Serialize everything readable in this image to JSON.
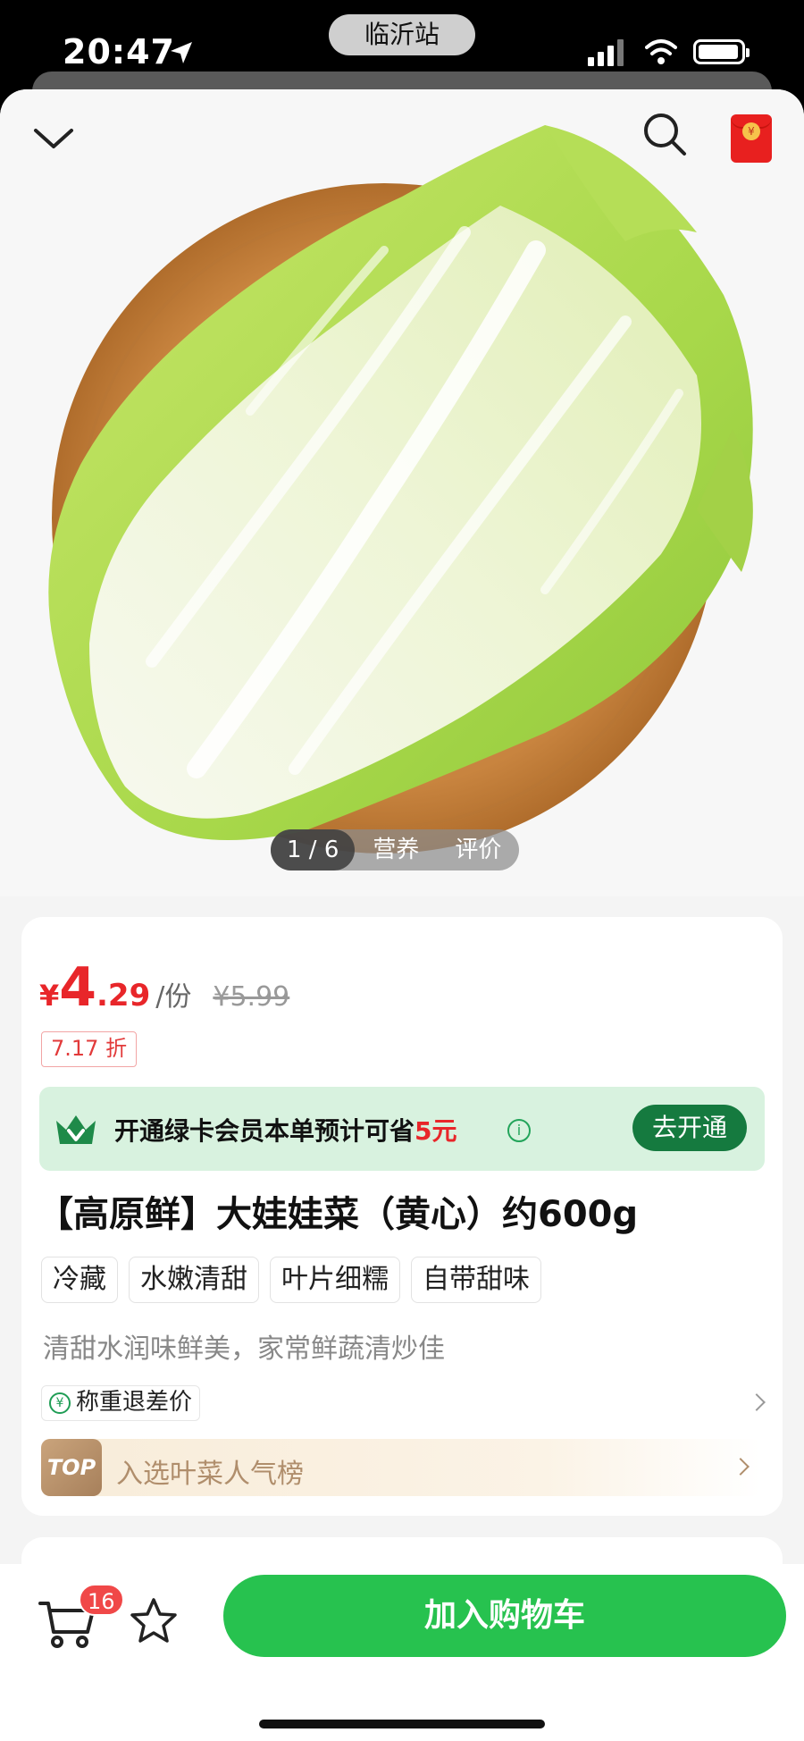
{
  "status_bar": {
    "time": "20:47",
    "station": "临沂站"
  },
  "gallery": {
    "image_subject": "napa cabbage on wooden plate",
    "pager_count": "1 / 6",
    "tabs": [
      "营养",
      "评价"
    ]
  },
  "price": {
    "currency": "¥",
    "integer": "4",
    "decimal": ".29",
    "unit": "/份",
    "original": "¥5.99",
    "discount": "7.17 折"
  },
  "member_banner": {
    "text_before": "开通绿卡会员本单预计可省",
    "save_amount": "5元",
    "info_glyph": "i",
    "cta": "去开通"
  },
  "product": {
    "title": "【高原鲜】大娃娃菜（黄心）约600g",
    "tags": [
      "冷藏",
      "水嫩清甜",
      "叶片细糯",
      "自带甜味"
    ],
    "subtitle": "清甜水润味鲜美，家常鲜蔬清炒佳",
    "refund_icon_glyph": "¥",
    "refund_label": "称重退差价",
    "rank_badge": "TOP",
    "rank_label": "入选叶菜人气榜"
  },
  "bottom_bar": {
    "cart_count": "16",
    "add_to_cart": "加入购物车"
  },
  "colors": {
    "price_red": "#e8262a",
    "member_green": "#157a3f",
    "cta_green": "#27c24f",
    "badge_red": "#f04848"
  }
}
